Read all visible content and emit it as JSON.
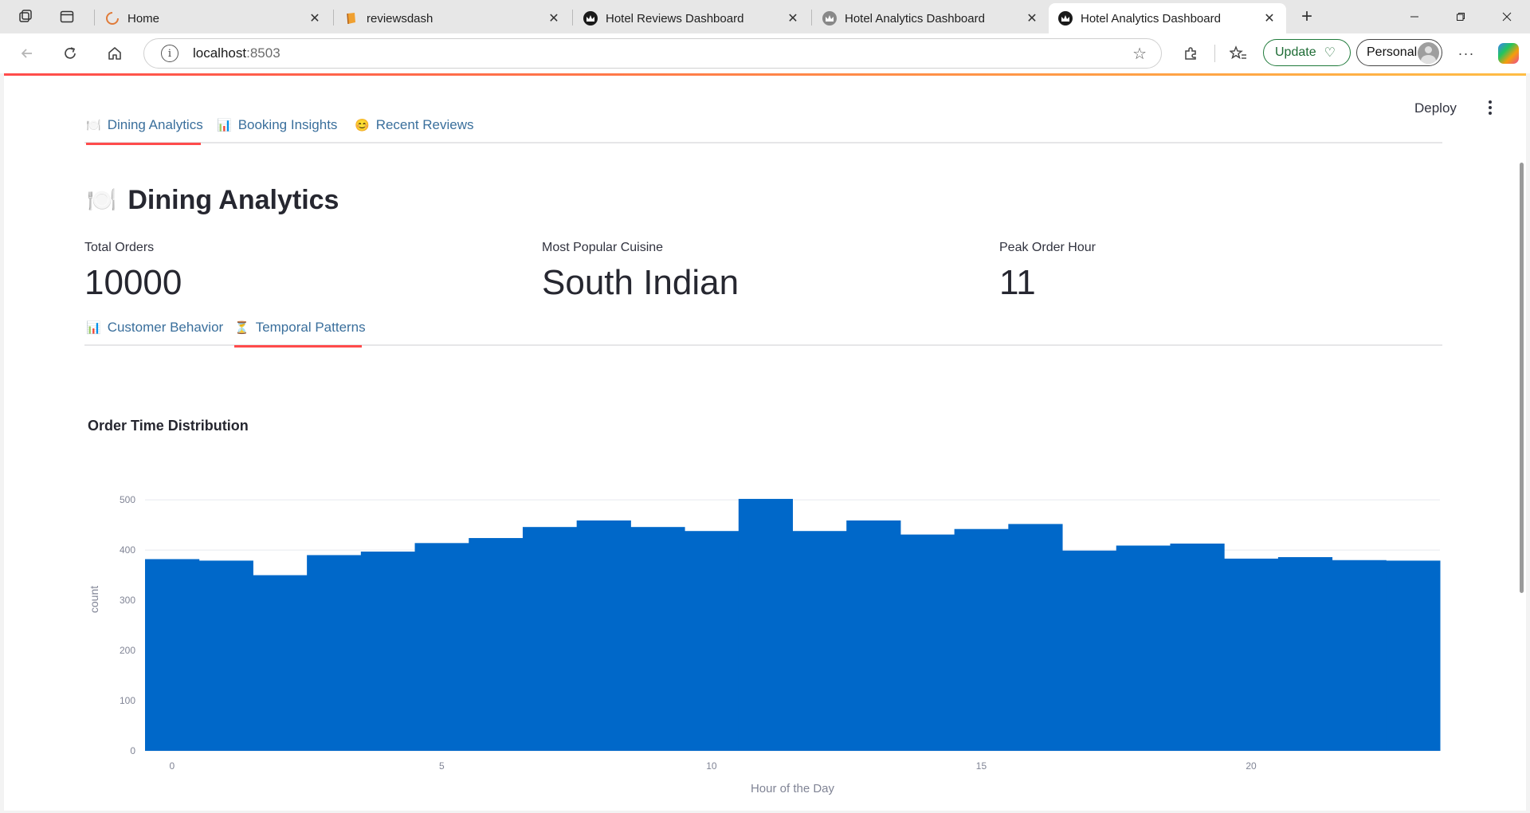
{
  "browser": {
    "tabs": [
      {
        "title": "Home",
        "icon": "spinner-icon"
      },
      {
        "title": "reviewsdash",
        "icon": "book-icon"
      },
      {
        "title": "Hotel Reviews Dashboard",
        "icon": "streamlit-crown-icon"
      },
      {
        "title": "Hotel Analytics Dashboard",
        "icon": "streamlit-crown-icon"
      },
      {
        "title": "Hotel Analytics Dashboard",
        "icon": "streamlit-crown-icon",
        "active": true
      }
    ],
    "address": {
      "host": "localhost",
      "port": ":8503"
    },
    "update_label": "Update",
    "profile_label": "Personal"
  },
  "app": {
    "deploy_label": "Deploy",
    "main_tabs": [
      {
        "emoji": "🍽️",
        "label": "Dining Analytics",
        "active": true
      },
      {
        "emoji": "📊",
        "label": "Booking Insights"
      },
      {
        "emoji": "😊",
        "label": "Recent Reviews"
      }
    ],
    "title": {
      "emoji": "🍽️",
      "text": "Dining Analytics"
    },
    "metrics": [
      {
        "label": "Total Orders",
        "value": "10000"
      },
      {
        "label": "Most Popular Cuisine",
        "value": "South Indian"
      },
      {
        "label": "Peak Order Hour",
        "value": "11"
      }
    ],
    "sub_tabs": [
      {
        "emoji": "📊",
        "label": "Customer Behavior"
      },
      {
        "emoji": "⏳",
        "label": "Temporal Patterns",
        "active": true
      }
    ],
    "colors": {
      "accent": "#ff4b4b",
      "bar": "#0068c9",
      "tab_text": "#3a6f9c"
    }
  },
  "chart_data": {
    "type": "bar",
    "title": "Order Time Distribution",
    "xlabel": "Hour of the Day",
    "ylabel": "count",
    "x": [
      0,
      1,
      2,
      3,
      4,
      5,
      6,
      7,
      8,
      9,
      10,
      11,
      12,
      13,
      14,
      15,
      16,
      17,
      18,
      19,
      20,
      21,
      22,
      23
    ],
    "values": [
      382,
      379,
      350,
      390,
      397,
      414,
      424,
      446,
      459,
      446,
      438,
      502,
      438,
      459,
      431,
      442,
      452,
      399,
      409,
      413,
      383,
      386,
      380,
      379
    ],
    "xticks": [
      0,
      5,
      10,
      15,
      20
    ],
    "yticks": [
      0,
      100,
      200,
      300,
      400,
      500
    ],
    "ylim": [
      0,
      540
    ],
    "grid": true,
    "color": "#0068c9"
  }
}
